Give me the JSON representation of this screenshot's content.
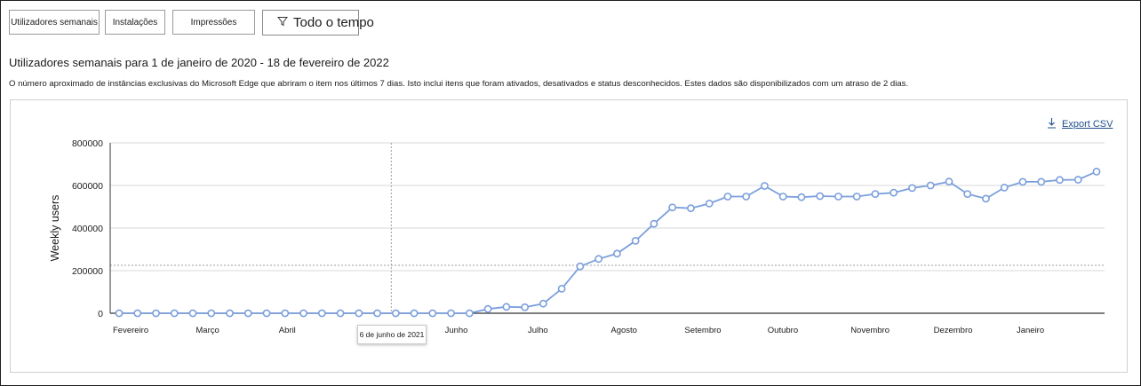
{
  "tabs": [
    {
      "label": "Utilizadores semanais",
      "active": true
    },
    {
      "label": "Instalações",
      "active": false
    },
    {
      "label": "Impressões",
      "active": false
    }
  ],
  "filter": {
    "label": "Todo o tempo",
    "icon": "filter-icon"
  },
  "heading": "Utilizadores semanais para 1 de janeiro de 2020 - 18 de fevereiro de 2022",
  "description": "O número aproximado de instâncias exclusivas do Microsoft Edge que abriram o item nos últimos 7 dias. Isto inclui itens que foram ativados, desativados e status desconhecidos. Estes dados são disponibilizados com um atraso de 2 dias.",
  "export": {
    "label": "Export CSV",
    "icon": "download-icon"
  },
  "hover_label": "6 de junho de 2021",
  "colors": {
    "line": "#7b9fdc",
    "grid": "#d9d9d9",
    "axis": "#333333",
    "reference": "#9e9e9e"
  },
  "chart_data": {
    "type": "line",
    "ylabel": "Weekly users",
    "ylim": [
      0,
      800000
    ],
    "yticks": [
      0,
      200000,
      400000,
      600000,
      800000
    ],
    "ytick_labels": [
      "0",
      "200000",
      "400000",
      "600000",
      "800000"
    ],
    "xtick_labels": [
      "Fevereiro",
      "Março",
      "Abril",
      "Junho",
      "Julho",
      "Agosto",
      "Setembro",
      "Outubro",
      "Novembro",
      "Dezembro",
      "Janeiro"
    ],
    "xtick_index": [
      0,
      4.5,
      9,
      18,
      22.5,
      27,
      31,
      35.5,
      40,
      44.5,
      49
    ],
    "hover_index": 15,
    "reference_value": 225000,
    "series": [
      {
        "values": [
          0,
          0,
          0,
          0,
          0,
          0,
          0,
          0,
          0,
          0,
          0,
          0,
          0,
          0,
          0,
          0,
          0,
          0,
          0,
          0,
          20000,
          30000,
          28000,
          45000,
          115000,
          220000,
          255000,
          280000,
          340000,
          420000,
          497000,
          493000,
          515000,
          548000,
          548000,
          598000,
          548000,
          545000,
          550000,
          548000,
          548000,
          560000,
          566000,
          588000,
          600000,
          618000,
          560000,
          538000,
          590000,
          617000,
          617000,
          626000,
          627000,
          665000
        ]
      }
    ]
  }
}
